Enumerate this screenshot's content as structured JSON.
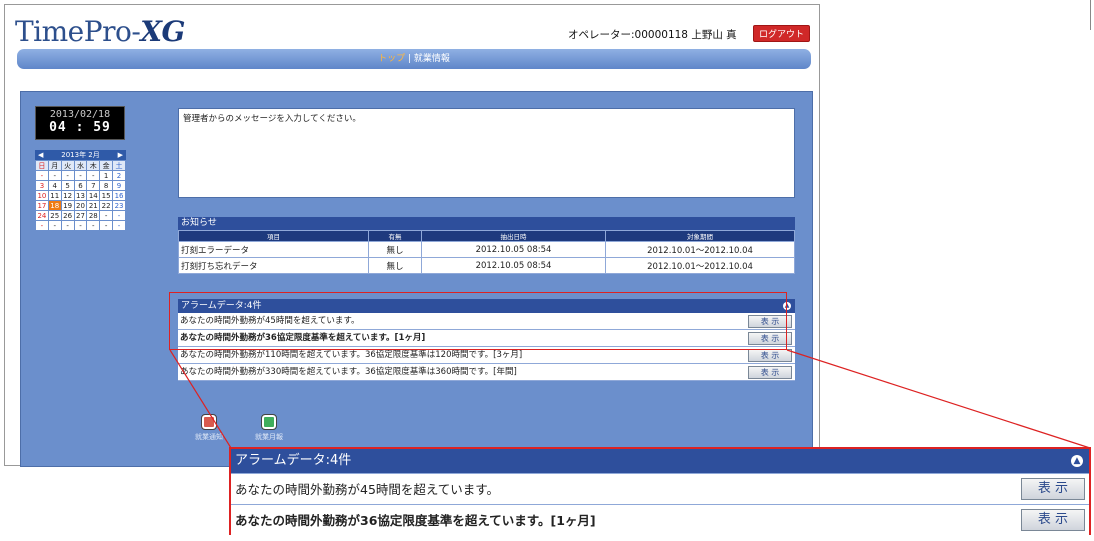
{
  "brand": {
    "name": "TimePro-",
    "suffix": "XG"
  },
  "header": {
    "operator": "オペレーター:00000118 上野山 真",
    "logout": "ログアウト"
  },
  "nav": {
    "current": "トップ",
    "sep": " | ",
    "item": "就業情報"
  },
  "clock": {
    "date": "2013/02/18",
    "time": "04 : 59"
  },
  "calendar": {
    "title": "2013年 2月",
    "prev": "◀",
    "next": "▶",
    "weekdays": [
      "日",
      "月",
      "火",
      "水",
      "木",
      "金",
      "土"
    ],
    "weeks": [
      [
        "-",
        "-",
        "-",
        "-",
        "-",
        "1",
        "2"
      ],
      [
        "3",
        "4",
        "5",
        "6",
        "7",
        "8",
        "9"
      ],
      [
        "10",
        "11",
        "12",
        "13",
        "14",
        "15",
        "16"
      ],
      [
        "17",
        "18",
        "19",
        "20",
        "21",
        "22",
        "23"
      ],
      [
        "24",
        "25",
        "26",
        "27",
        "28",
        "-",
        "-"
      ],
      [
        "-",
        "-",
        "-",
        "-",
        "-",
        "-",
        "-"
      ]
    ],
    "today": "18"
  },
  "message": "管理者からのメッセージを入力してください。",
  "notice": {
    "title": "お知らせ",
    "headers": [
      "項目",
      "有無",
      "抽出日時",
      "対象期間"
    ],
    "rows": [
      [
        "打刻エラーデータ",
        "無し",
        "2012.10.05 08:54",
        "2012.10.01～2012.10.04"
      ],
      [
        "打刻打ち忘れデータ",
        "無し",
        "2012.10.05 08:54",
        "2012.10.01～2012.10.04"
      ]
    ]
  },
  "alarm": {
    "title": "アラームデータ:4件",
    "show": "表 示",
    "rows": [
      "あなたの時間外勤務が45時間を超えています。",
      "あなたの時間外勤務が36協定限度基準を超えています。[1ヶ月]",
      "あなたの時間外勤務が110時間を超えています。36協定限度基準は120時間です。[3ヶ月]",
      "あなたの時間外勤務が330時間を超えています。36協定限度基準は360時間です。[年間]"
    ]
  },
  "icons": {
    "left": "就業通知",
    "right": "就業月報"
  },
  "zoom": {
    "title": "アラームデータ:4件",
    "show": "表 示",
    "rows": [
      "あなたの時間外勤務が45時間を超えています。",
      "あなたの時間外勤務が36協定限度基準を超えています。[1ヶ月]"
    ]
  }
}
